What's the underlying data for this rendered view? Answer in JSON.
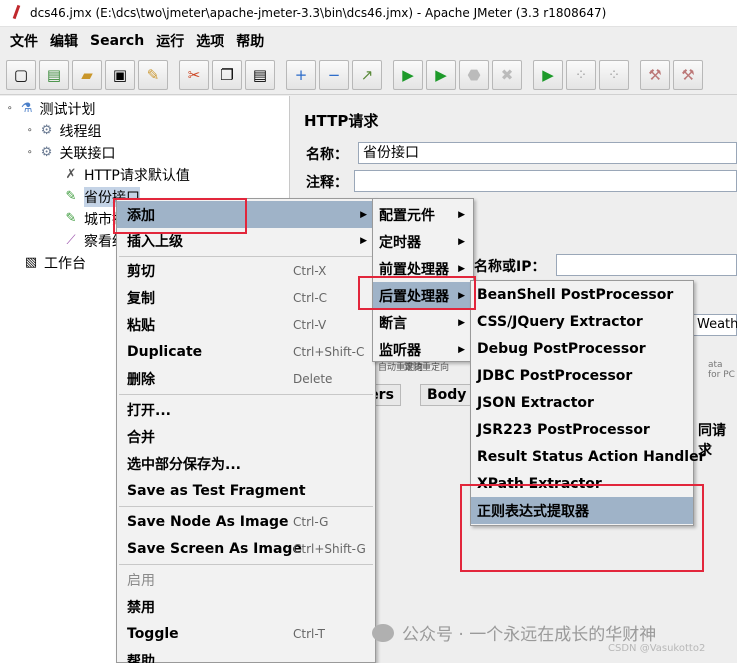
{
  "window": {
    "title": "dcs46.jmx (E:\\dcs\\two\\jmeter\\apache-jmeter-3.3\\bin\\dcs46.jmx) - Apache JMeter (3.3 r1808647)"
  },
  "menubar": [
    "文件",
    "编辑",
    "Search",
    "运行",
    "选项",
    "帮助"
  ],
  "toolbar": [
    "new-icon",
    "templates-icon",
    "open-icon",
    "save-icon",
    "save-as-icon",
    "cut-icon",
    "copy-icon",
    "paste-icon",
    "expand-icon",
    "collapse-icon",
    "toggle-icon",
    "start-icon",
    "start-no-pause-icon",
    "stop-icon",
    "shutdown-icon",
    "remote-start-icon",
    "remote-stop-icon",
    "remote-shutdown-icon",
    "clear-icon",
    "clear-all-icon"
  ],
  "tree": {
    "test_plan": "测试计划",
    "thread_group": "线程组",
    "controller": "关联接口",
    "http_defaults": "HTTP请求默认值",
    "province": "省份接口",
    "city": "城市接",
    "viewer": "察看结",
    "workbench": "工作台"
  },
  "right": {
    "title": "HTTP请求",
    "name_label": "名称：",
    "name_value": "省份接口",
    "comment_label": "注释：",
    "server_label": "名称或IP：",
    "weather_fragment": "Weathe",
    "hint_fragment": "ata for PC",
    "chk_fragment": "跟随重定向",
    "auto_fragment": "自动重定向",
    "tab_params": "eters",
    "tab_body": "Body D",
    "same_req": "同请求"
  },
  "ctx_main": {
    "items": [
      {
        "label": "添加",
        "submenu": true
      },
      {
        "label": "插入上级",
        "submenu": true
      },
      {
        "label": "剪切",
        "accel": "Ctrl-X"
      },
      {
        "label": "复制",
        "accel": "Ctrl-C"
      },
      {
        "label": "粘贴",
        "accel": "Ctrl-V"
      },
      {
        "label": "Duplicate",
        "accel": "Ctrl+Shift-C"
      },
      {
        "label": "删除",
        "accel": "Delete"
      },
      {
        "label": "打开..."
      },
      {
        "label": "合并"
      },
      {
        "label": "选中部分保存为..."
      },
      {
        "label": "Save as Test Fragment"
      },
      {
        "label": "Save Node As Image",
        "accel": "Ctrl-G"
      },
      {
        "label": "Save Screen As Image",
        "accel": "Ctrl+Shift-G"
      },
      {
        "label": "启用"
      },
      {
        "label": "禁用"
      },
      {
        "label": "Toggle",
        "accel": "Ctrl-T"
      },
      {
        "label": "帮助"
      }
    ]
  },
  "ctx_add": {
    "items": [
      {
        "label": "配置元件"
      },
      {
        "label": "定时器"
      },
      {
        "label": "前置处理器"
      },
      {
        "label": "后置处理器"
      },
      {
        "label": "断言"
      },
      {
        "label": "监听器"
      }
    ]
  },
  "ctx_post": {
    "items": [
      "BeanShell PostProcessor",
      "CSS/JQuery Extractor",
      "Debug PostProcessor",
      "JDBC PostProcessor",
      "JSON Extractor",
      "JSR223 PostProcessor",
      "Result Status Action Handler",
      "XPath Extractor",
      "正则表达式提取器"
    ]
  },
  "watermark": {
    "text": "公众号 · 一个永远在成长的华财神",
    "small": "CSDN @Vasukotto2"
  },
  "colors": {
    "highlight": "#9fb3c8",
    "annotation": "#e2263b",
    "selection": "#c4d3e6"
  }
}
